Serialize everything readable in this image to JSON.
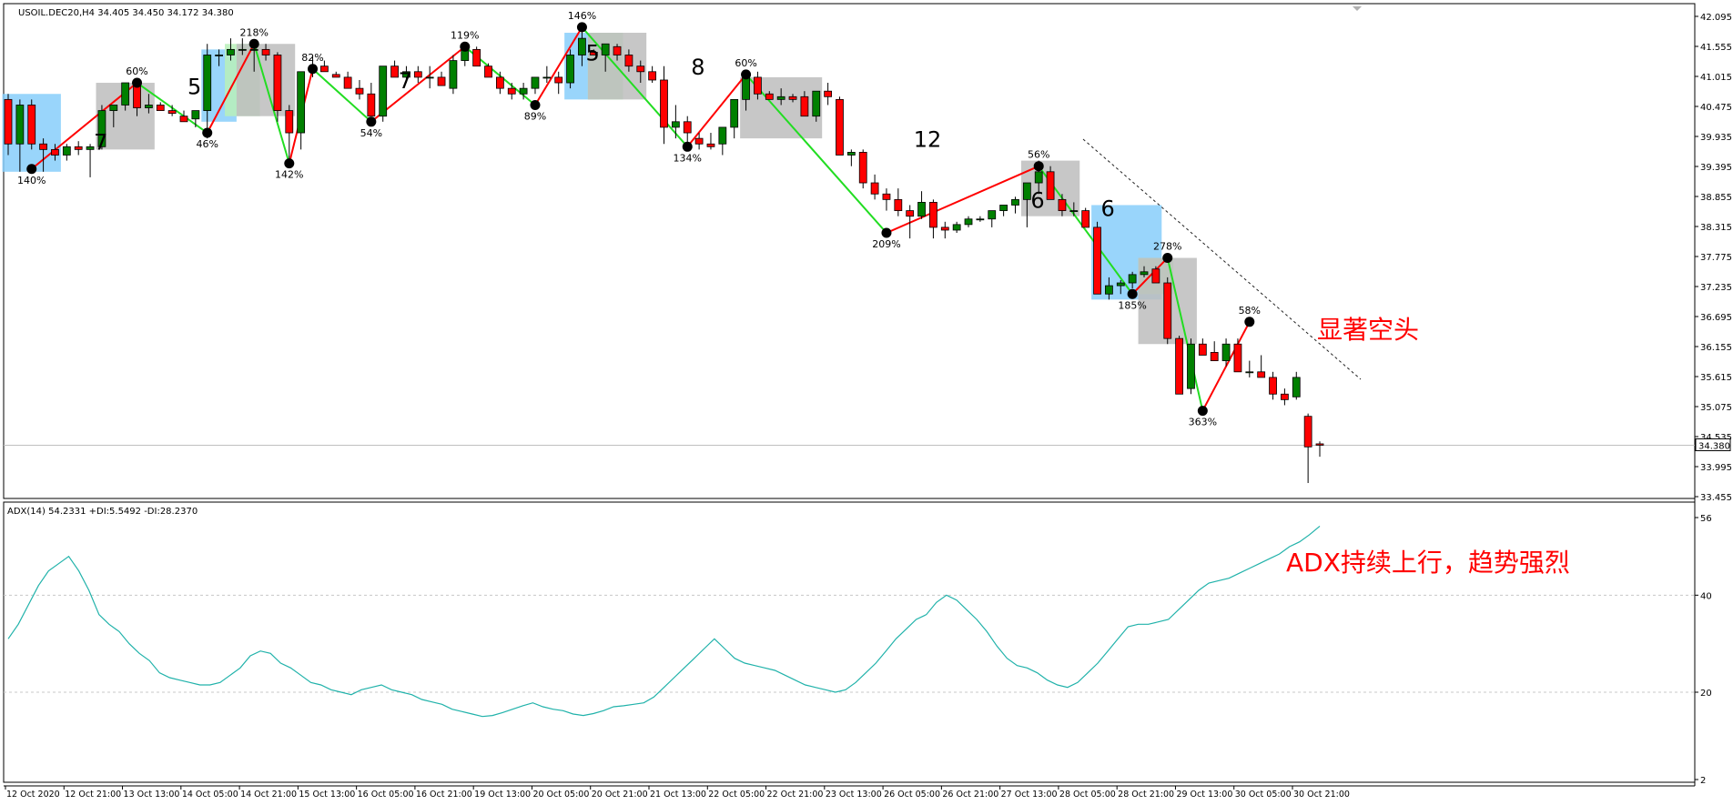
{
  "chart_data": [
    {
      "type": "candlestick",
      "symbol_header": "USOIL.DEC20,H4  34.405 34.450 34.172 34.380",
      "last_price": "34.380",
      "ylim": [
        33.455,
        42.095
      ],
      "y_ticks": [
        "42.095",
        "41.555",
        "41.015",
        "40.475",
        "39.935",
        "39.395",
        "38.855",
        "38.315",
        "37.775",
        "37.235",
        "36.695",
        "36.155",
        "35.615",
        "35.075",
        "34.535",
        "33.995",
        "33.455"
      ],
      "x_ticks": [
        "12 Oct 2020",
        "12 Oct 21:00",
        "13 Oct 13:00",
        "14 Oct 05:00",
        "14 Oct 21:00",
        "15 Oct 13:00",
        "16 Oct 05:00",
        "16 Oct 21:00",
        "19 Oct 13:00",
        "20 Oct 05:00",
        "20 Oct 21:00",
        "21 Oct 13:00",
        "22 Oct 05:00",
        "22 Oct 21:00",
        "23 Oct 13:00",
        "26 Oct 05:00",
        "26 Oct 21:00",
        "27 Oct 13:00",
        "28 Oct 05:00",
        "28 Oct 21:00",
        "29 Oct 13:00",
        "30 Oct 05:00",
        "30 Oct 21:00"
      ],
      "candles": [
        [
          40.6,
          40.7,
          39.6,
          39.8
        ],
        [
          39.8,
          40.6,
          39.3,
          40.5
        ],
        [
          40.5,
          40.6,
          39.7,
          39.8
        ],
        [
          39.8,
          39.9,
          39.3,
          39.7
        ],
        [
          39.7,
          39.8,
          39.5,
          39.6
        ],
        [
          39.6,
          39.8,
          39.5,
          39.75
        ],
        [
          39.75,
          39.85,
          39.6,
          39.7
        ],
        [
          39.7,
          39.8,
          39.2,
          39.75
        ],
        [
          39.75,
          40.5,
          39.7,
          40.4
        ],
        [
          40.4,
          40.5,
          40.1,
          40.5
        ],
        [
          40.5,
          40.9,
          40.4,
          40.9
        ],
        [
          40.9,
          40.9,
          40.3,
          40.45
        ],
        [
          40.45,
          40.7,
          40.35,
          40.5
        ],
        [
          40.5,
          40.55,
          40.4,
          40.4
        ],
        [
          40.4,
          40.5,
          40.3,
          40.35
        ],
        [
          40.3,
          40.4,
          40.2,
          40.2
        ],
        [
          40.25,
          40.4,
          40.1,
          40.4
        ],
        [
          40.4,
          41.6,
          39.9,
          41.4
        ],
        [
          41.4,
          41.5,
          41.2,
          41.4
        ],
        [
          41.4,
          41.7,
          41.3,
          41.5
        ],
        [
          41.5,
          41.7,
          41.4,
          41.5
        ],
        [
          41.5,
          41.6,
          41.1,
          41.5
        ],
        [
          41.5,
          41.6,
          41.3,
          41.4
        ],
        [
          41.4,
          41.45,
          40.2,
          40.4
        ],
        [
          40.4,
          40.5,
          39.5,
          40.0
        ],
        [
          40.0,
          41.1,
          39.7,
          41.1
        ],
        [
          41.1,
          41.4,
          41.0,
          41.2
        ],
        [
          41.2,
          41.3,
          41.1,
          41.1
        ],
        [
          41.05,
          41.1,
          41.0,
          41.0
        ],
        [
          41.0,
          41.1,
          40.8,
          40.8
        ],
        [
          40.8,
          40.95,
          40.6,
          40.7
        ],
        [
          40.7,
          40.9,
          40.3,
          40.3
        ],
        [
          40.3,
          41.2,
          40.2,
          41.2
        ],
        [
          41.2,
          41.3,
          41.0,
          41.0
        ],
        [
          41.0,
          41.2,
          40.9,
          41.1
        ],
        [
          41.1,
          41.2,
          40.9,
          41.0
        ],
        [
          41.0,
          41.2,
          40.8,
          41.0
        ],
        [
          41.0,
          41.1,
          40.9,
          40.85
        ],
        [
          40.8,
          41.4,
          40.7,
          41.3
        ],
        [
          41.3,
          41.6,
          41.2,
          41.5
        ],
        [
          41.5,
          41.55,
          41.2,
          41.2
        ],
        [
          41.2,
          41.25,
          41.0,
          41.0
        ],
        [
          41.0,
          41.1,
          40.7,
          40.8
        ],
        [
          40.8,
          40.9,
          40.6,
          40.7
        ],
        [
          40.7,
          40.9,
          40.6,
          40.8
        ],
        [
          40.8,
          41.0,
          40.7,
          41.0
        ],
        [
          41.0,
          41.2,
          40.9,
          41.0
        ],
        [
          41.0,
          41.1,
          40.7,
          40.9
        ],
        [
          40.9,
          41.5,
          40.8,
          41.4
        ],
        [
          41.4,
          41.9,
          41.2,
          41.7
        ],
        [
          41.45,
          41.5,
          41.4,
          41.4
        ],
        [
          41.4,
          41.6,
          41.1,
          41.6
        ],
        [
          41.55,
          41.6,
          41.3,
          41.4
        ],
        [
          41.4,
          41.5,
          41.1,
          41.2
        ],
        [
          41.2,
          41.3,
          40.9,
          41.1
        ],
        [
          41.1,
          41.2,
          40.9,
          40.95
        ],
        [
          40.95,
          41.2,
          39.8,
          40.1
        ],
        [
          40.1,
          40.5,
          39.9,
          40.2
        ],
        [
          40.2,
          40.3,
          39.8,
          40.0
        ],
        [
          39.9,
          40.0,
          39.7,
          39.8
        ],
        [
          39.8,
          40.0,
          39.7,
          39.75
        ],
        [
          39.8,
          40.1,
          39.6,
          40.1
        ],
        [
          40.1,
          40.6,
          39.9,
          40.6
        ],
        [
          40.6,
          41.1,
          40.4,
          41.0
        ],
        [
          41.0,
          41.1,
          40.6,
          40.7
        ],
        [
          40.7,
          40.75,
          40.6,
          40.6
        ],
        [
          40.6,
          40.8,
          40.5,
          40.65
        ],
        [
          40.65,
          40.7,
          40.55,
          40.6
        ],
        [
          40.65,
          40.75,
          40.3,
          40.3
        ],
        [
          40.3,
          40.7,
          40.2,
          40.75
        ],
        [
          40.75,
          40.9,
          40.5,
          40.65
        ],
        [
          40.6,
          40.65,
          39.6,
          39.6
        ],
        [
          39.6,
          39.7,
          39.4,
          39.65
        ],
        [
          39.65,
          39.7,
          39.0,
          39.1
        ],
        [
          39.1,
          39.25,
          38.8,
          38.9
        ],
        [
          38.9,
          39.0,
          38.6,
          38.8
        ],
        [
          38.8,
          39.0,
          38.5,
          38.6
        ],
        [
          38.6,
          38.7,
          38.1,
          38.5
        ],
        [
          38.5,
          38.95,
          38.45,
          38.75
        ],
        [
          38.75,
          38.8,
          38.1,
          38.3
        ],
        [
          38.3,
          38.4,
          38.1,
          38.25
        ],
        [
          38.25,
          38.4,
          38.2,
          38.35
        ],
        [
          38.35,
          38.5,
          38.3,
          38.45
        ],
        [
          38.45,
          38.5,
          38.4,
          38.45
        ],
        [
          38.45,
          38.55,
          38.3,
          38.6
        ],
        [
          38.6,
          38.7,
          38.5,
          38.7
        ],
        [
          38.7,
          38.85,
          38.55,
          38.8
        ],
        [
          38.8,
          39.1,
          38.3,
          39.1
        ],
        [
          39.1,
          39.5,
          38.9,
          39.3
        ],
        [
          39.3,
          39.4,
          38.9,
          38.8
        ],
        [
          38.8,
          38.9,
          38.5,
          38.6
        ],
        [
          38.6,
          38.75,
          38.5,
          38.6
        ],
        [
          38.6,
          38.65,
          38.3,
          38.3
        ],
        [
          38.3,
          38.4,
          37.1,
          37.1
        ],
        [
          37.1,
          37.4,
          37.0,
          37.25
        ],
        [
          37.25,
          37.35,
          37.1,
          37.3
        ],
        [
          37.3,
          37.5,
          37.2,
          37.45
        ],
        [
          37.45,
          37.6,
          37.4,
          37.5
        ],
        [
          37.55,
          37.6,
          37.4,
          37.3
        ],
        [
          37.3,
          37.4,
          36.2,
          36.3
        ],
        [
          36.3,
          36.35,
          35.3,
          35.3
        ],
        [
          35.4,
          36.3,
          35.3,
          36.2
        ],
        [
          36.2,
          36.3,
          36.0,
          36.0
        ],
        [
          36.05,
          36.25,
          35.9,
          35.9
        ],
        [
          35.9,
          36.3,
          35.8,
          36.2
        ],
        [
          36.2,
          36.3,
          35.7,
          35.7
        ],
        [
          35.7,
          35.9,
          35.6,
          35.7
        ],
        [
          35.7,
          36.0,
          35.6,
          35.6
        ],
        [
          35.6,
          35.7,
          35.2,
          35.3
        ],
        [
          35.3,
          35.4,
          35.1,
          35.2
        ],
        [
          35.25,
          35.7,
          35.2,
          35.6
        ],
        [
          34.9,
          34.95,
          33.7,
          34.35
        ],
        [
          34.405,
          34.45,
          34.172,
          34.38
        ]
      ]
    },
    {
      "type": "line",
      "header": "ADX(14) 54.2331 +DI:5.5492 -DI:28.2370",
      "ylim": [
        2,
        56
      ],
      "y_ticks": [
        "56",
        "40",
        "20",
        "2"
      ],
      "series": [
        {
          "values": [
            31,
            34,
            38,
            42,
            45,
            46.5,
            48,
            45,
            41,
            36,
            34,
            32.5,
            30,
            28,
            26.5,
            24,
            23,
            22.5,
            22,
            21.5,
            21.5,
            22,
            23.5,
            25,
            27.5,
            28.5,
            28,
            26,
            25,
            23.5,
            22,
            21.5,
            20.5,
            20,
            19.5,
            20.5,
            21,
            21.5,
            20.5,
            20,
            19.5,
            18.5,
            18,
            17.5,
            16.5,
            16,
            15.5,
            15,
            15.2,
            15.8,
            16.5,
            17.2,
            17.8,
            17,
            16.5,
            16.2,
            15.5,
            15.2,
            15.6,
            16.2,
            17,
            17.2,
            17.5,
            17.8,
            19,
            21,
            23,
            25,
            27,
            29,
            31,
            29,
            27,
            26,
            25.5,
            25,
            24.5,
            23.5,
            22.5,
            21.5,
            21,
            20.5,
            20,
            20.5,
            22,
            24,
            26,
            28.5,
            31,
            33,
            35,
            36,
            38.5,
            40,
            39,
            37,
            35,
            32.5,
            29.5,
            27,
            25.5,
            25,
            24,
            22.5,
            21.5,
            21,
            22,
            24,
            26,
            28.5,
            31,
            33.5,
            34,
            34,
            34.5,
            35,
            37,
            39,
            41,
            42.5,
            43,
            43.5,
            44.5,
            45.5,
            46.5,
            47.5,
            48.5,
            50,
            51,
            52.5,
            54.2331
          ]
        }
      ]
    }
  ],
  "annotations": {
    "bearish_note": "显著空头",
    "adx_note": "ADX持续上行，趋势强烈",
    "numerals": [
      "7",
      "5",
      "7",
      "5",
      "8",
      "12",
      "6",
      "6"
    ],
    "percent_labels": [
      "140%",
      "60%",
      "46%",
      "218%",
      "142%",
      "82%",
      "54%",
      "119%",
      "89%",
      "146%",
      "134%",
      "60%",
      "209%",
      "56%",
      "185%",
      "278%",
      "363%",
      "58%"
    ]
  },
  "colors": {
    "bull": "#008000",
    "bear": "#ff0000",
    "adx_line": "#20b2aa",
    "zig_up": "#ff0000",
    "zig_down": "#22dd22",
    "zone_blue": "#87cefa",
    "zone_gray": "#bdbdbd",
    "zone_green": "#b8f0b8",
    "note_text": "#ff0000"
  }
}
